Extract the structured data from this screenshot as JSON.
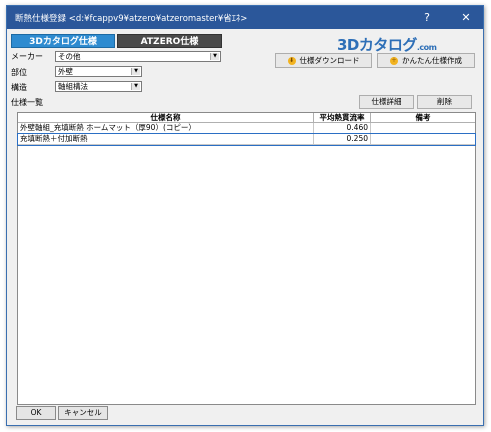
{
  "window": {
    "title": "断熱仕様登録 <d:¥fcappv9¥atzero¥atzeromaster¥省ｴﾈ>",
    "help": "?",
    "close": "✕"
  },
  "tabs": [
    "3Dカタログ仕様",
    "ATZERO仕様"
  ],
  "filters": {
    "maker_label": "メーカー",
    "maker_value": "その他",
    "part_label": "部位",
    "part_value": "外壁",
    "structure_label": "構造",
    "structure_value": "軸組構法"
  },
  "logo": {
    "main": "3Dカタログ",
    "suffix": ".com"
  },
  "buttons": {
    "download": "仕様ダウンロード",
    "easy_create": "かんたん仕様作成",
    "detail": "仕様詳細",
    "delete": "削除",
    "ok": "OK",
    "cancel": "キャンセル"
  },
  "list": {
    "label": "仕様一覧",
    "columns": [
      "仕様名称",
      "平均熱貫流率",
      "備考"
    ],
    "rows": [
      {
        "name": "外壁軸組_充填断熱 ホームマット（厚90）(コピー）",
        "value": "0.460",
        "note": ""
      },
      {
        "name": "充填断熱＋付加断熱",
        "value": "0.250",
        "note": ""
      }
    ]
  },
  "colors": {
    "titlebar": "#2b579a",
    "tab_active": "#2e8bd0",
    "tab_inactive": "#4a4a4a",
    "logo": "#2e6fb7",
    "selection": "#2b6fc4"
  }
}
